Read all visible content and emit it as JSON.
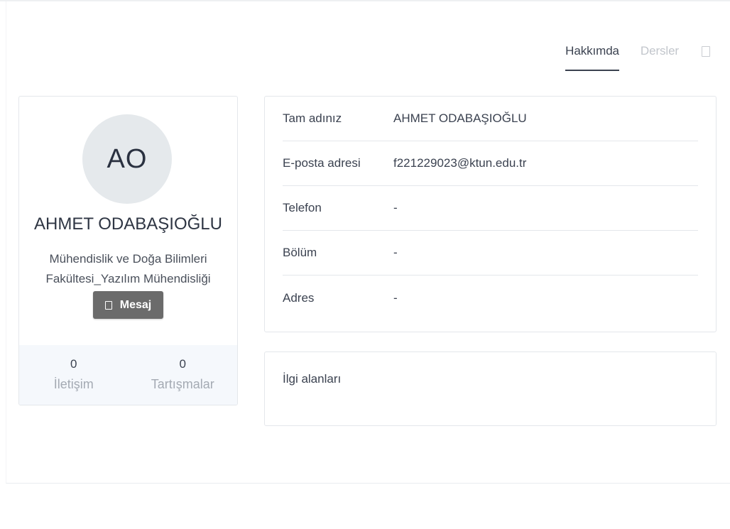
{
  "tabs": [
    {
      "label": "Hakkımda",
      "active": true
    },
    {
      "label": "Dersler",
      "active": false
    }
  ],
  "tab_extra_icon": "document-icon",
  "profile": {
    "initials": "AO",
    "name": "AHMET ODABAŞIOĞLU",
    "department": "Mühendislik ve Doğa Bilimleri Fakültesi_Yazılım Mühendisliği",
    "message_button": "Mesaj",
    "message_icon": "envelope-icon",
    "stats": [
      {
        "value": "0",
        "label": "İletişim"
      },
      {
        "value": "0",
        "label": "Tartışmalar"
      }
    ]
  },
  "info": [
    {
      "label": "Tam adınız",
      "value": "AHMET ODABAŞIOĞLU"
    },
    {
      "label": "E-posta adresi",
      "value": "f221229023@ktun.edu.tr"
    },
    {
      "label": "Telefon",
      "value": "-"
    },
    {
      "label": "Bölüm",
      "value": "-"
    },
    {
      "label": "Adres",
      "value": "-"
    }
  ],
  "interests": {
    "title": "İlgi alanları"
  },
  "colors": {
    "text": "#3b4250",
    "muted": "#a4aab3",
    "button": "#6b6b6b",
    "avatar_bg": "#e5e9ec",
    "stats_bg": "#f5f8fc",
    "border": "#e4e7eb"
  }
}
